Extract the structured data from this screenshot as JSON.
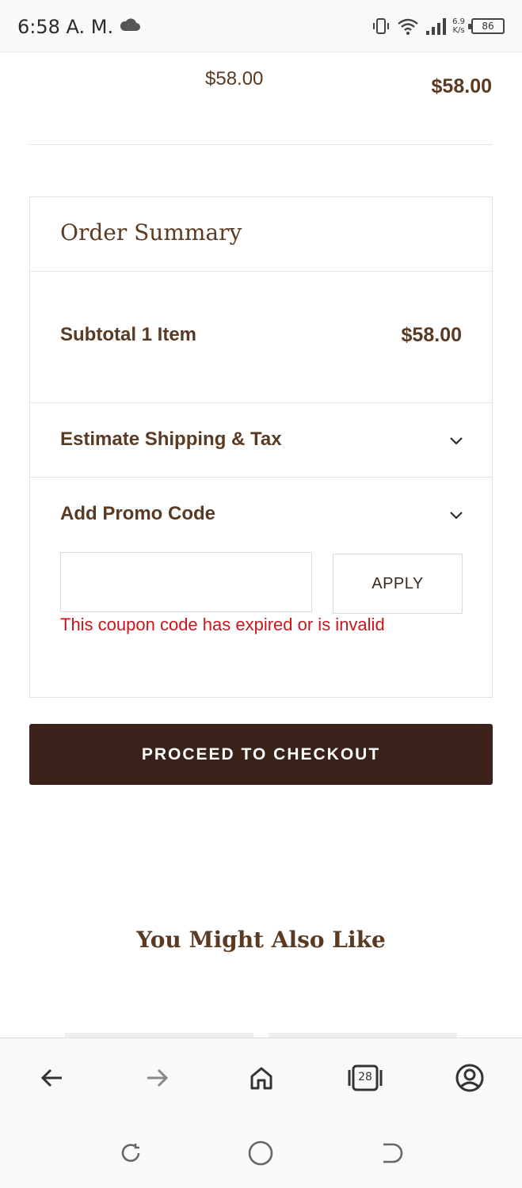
{
  "status_bar": {
    "time": "6:58 A. M.",
    "net_speed_value": "6.9",
    "net_speed_unit": "K/s",
    "battery": "86"
  },
  "cart_item": {
    "price": "$58.00",
    "total": "$58.00"
  },
  "order_summary": {
    "title": "Order Summary",
    "subtotal_label": "Subtotal 1 Item",
    "subtotal_value": "$58.00",
    "shipping_label": "Estimate Shipping & Tax",
    "promo_label": "Add Promo Code",
    "promo_input_value": "",
    "apply_label": "APPLY",
    "promo_error": "This coupon code has expired or is invalid"
  },
  "checkout_label": "PROCEED TO CHECKOUT",
  "recommendations_title": "You Might Also Like",
  "browser_toolbar": {
    "tab_count": "28"
  }
}
